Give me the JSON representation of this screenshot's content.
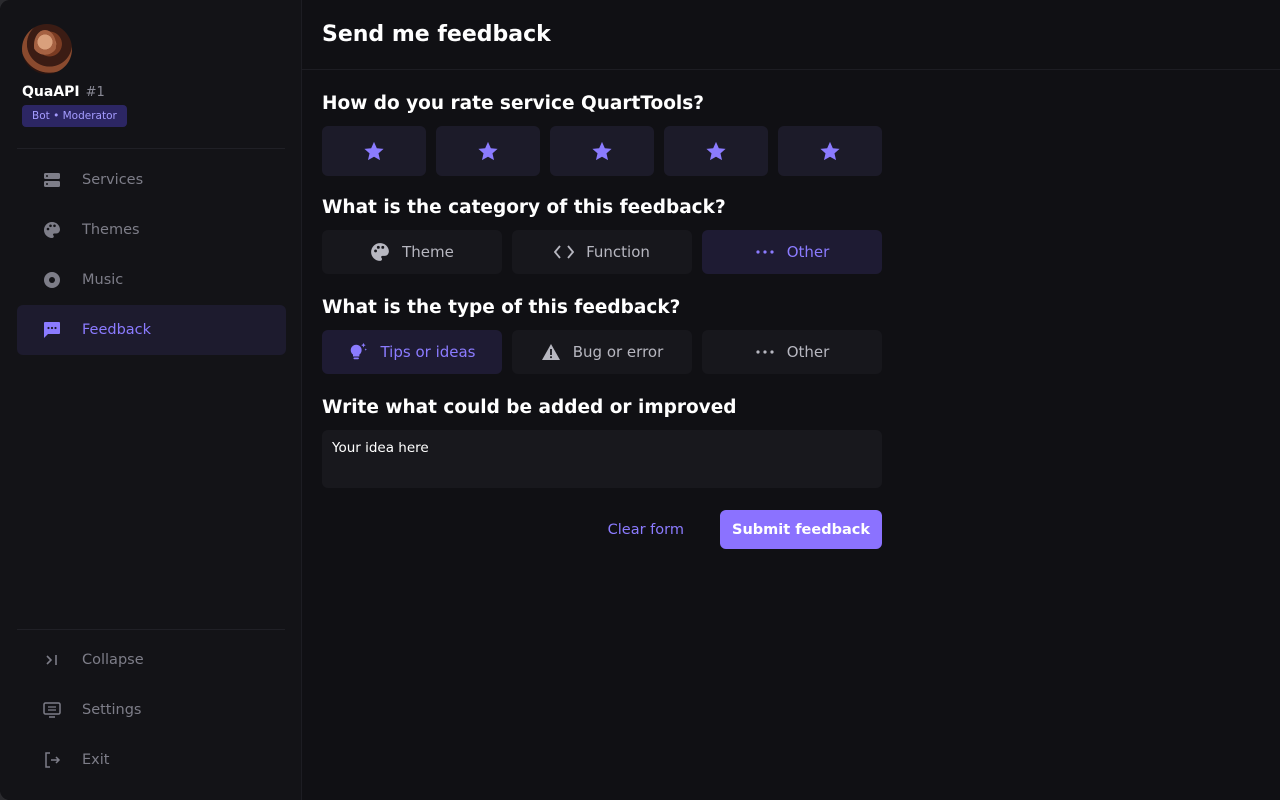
{
  "profile": {
    "name": "QuaAPI",
    "tag": "#1",
    "badge": "Bot • Moderator"
  },
  "nav": {
    "items": [
      {
        "label": "Services",
        "icon": "server-icon"
      },
      {
        "label": "Themes",
        "icon": "palette-icon"
      },
      {
        "label": "Music",
        "icon": "disc-icon"
      },
      {
        "label": "Feedback",
        "icon": "chat-icon",
        "active": true
      }
    ],
    "bottom": [
      {
        "label": "Collapse",
        "icon": "collapse-icon"
      },
      {
        "label": "Settings",
        "icon": "settings-icon"
      },
      {
        "label": "Exit",
        "icon": "exit-icon"
      }
    ]
  },
  "header": {
    "title": "Send me feedback"
  },
  "rating": {
    "question": "How do you rate service QuartTools?",
    "max_stars": 5
  },
  "category": {
    "question": "What is the category of this feedback?",
    "options": [
      {
        "label": "Theme",
        "icon": "palette-icon"
      },
      {
        "label": "Function",
        "icon": "code-icon"
      },
      {
        "label": "Other",
        "icon": "more-icon",
        "selected": true
      }
    ]
  },
  "type": {
    "question": "What is the type of this feedback?",
    "options": [
      {
        "label": "Tips or ideas",
        "icon": "lightbulb-icon",
        "selected": true
      },
      {
        "label": "Bug or error",
        "icon": "warning-icon"
      },
      {
        "label": "Other",
        "icon": "more-icon"
      }
    ]
  },
  "improve": {
    "question": "Write what could be added or improved",
    "placeholder": "Your idea here"
  },
  "actions": {
    "clear": "Clear form",
    "submit": "Submit feedback"
  },
  "colors": {
    "accent": "#8b7bff",
    "button": "#8b72ff",
    "background": "#101014",
    "sidebar": "#131317"
  }
}
